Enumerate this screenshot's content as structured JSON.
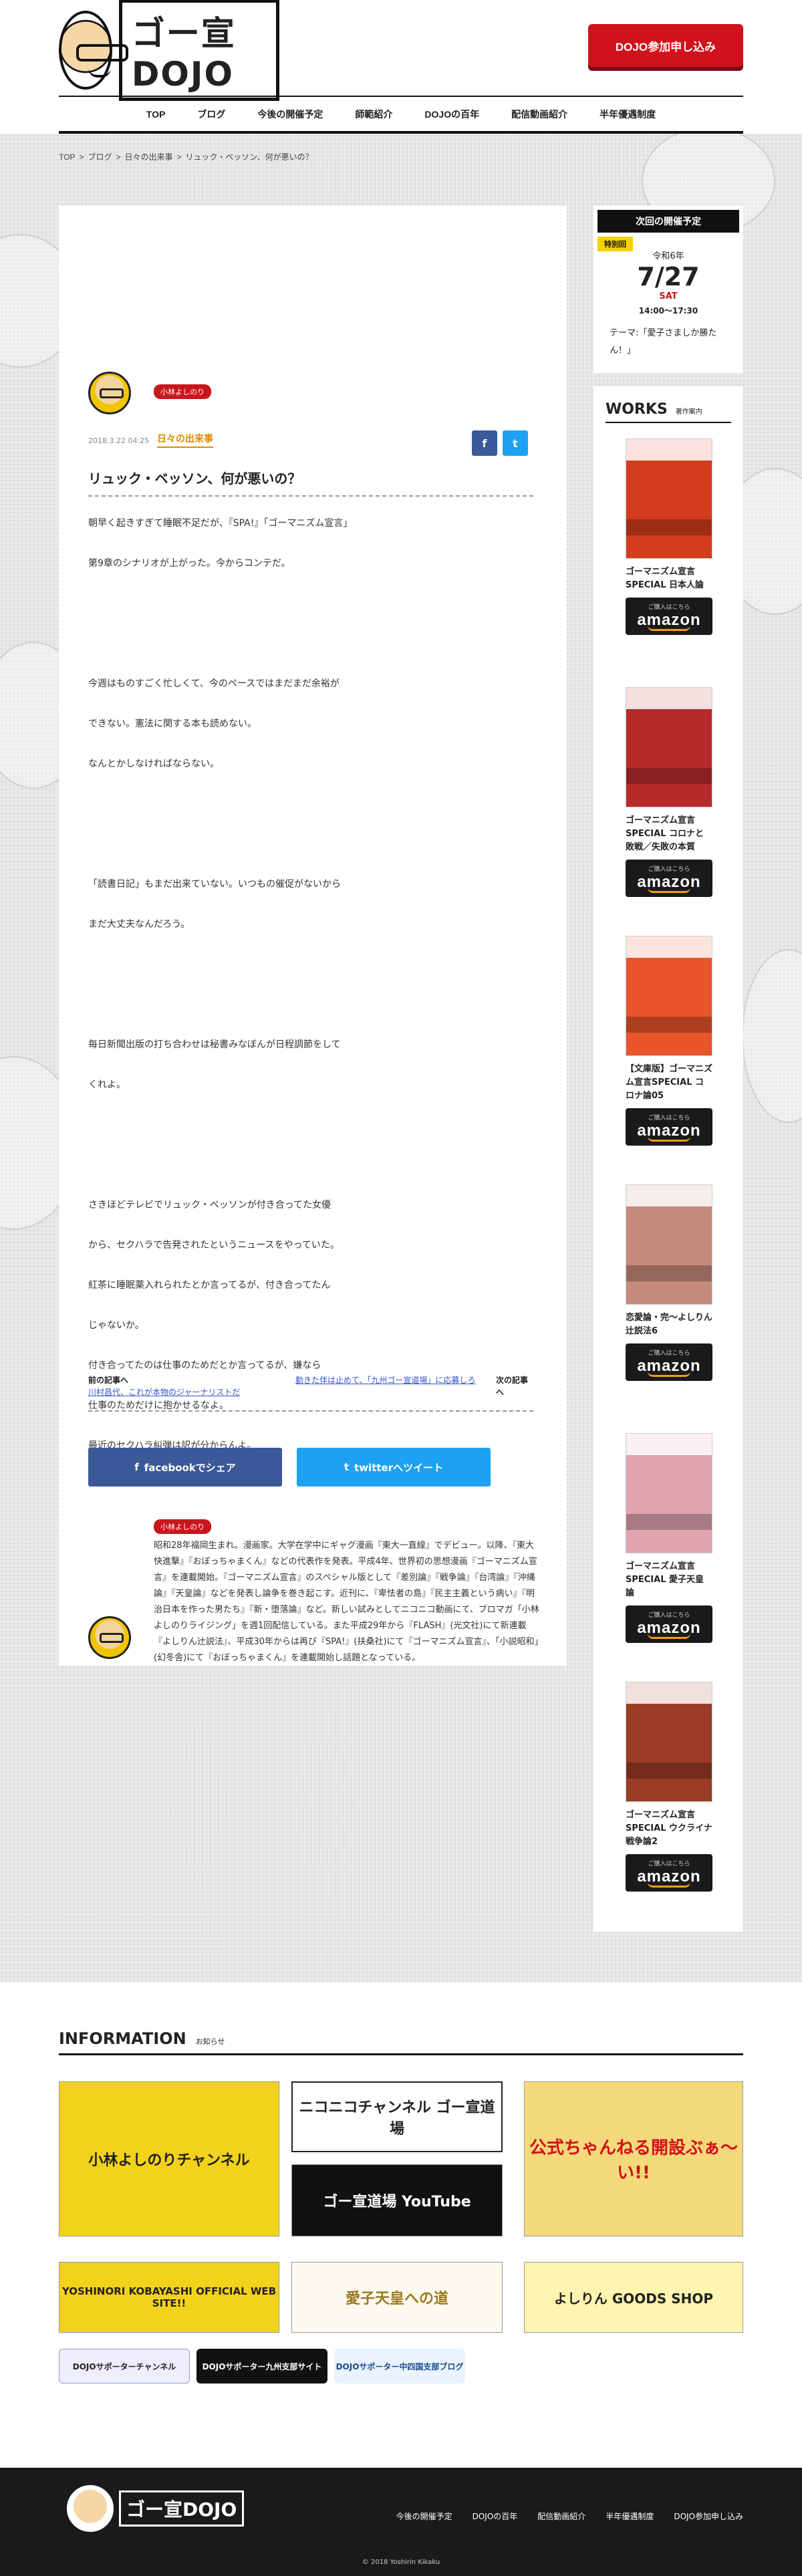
{
  "header": {
    "logo_text": "ゴー宣DOJO",
    "join_label": "DOJO参加申し込み",
    "nav": [
      "TOP",
      "ブログ",
      "今後の開催予定",
      "師範紹介",
      "DOJOの百年",
      "配信動画紹介",
      "半年優遇制度"
    ]
  },
  "breadcrumb": {
    "top": "TOP",
    "blog": "ブログ",
    "category": "日々の出来事",
    "current": "リュック・ベッソン、何が悪いの？",
    "sep": ">"
  },
  "article": {
    "author_tag": "小林よしのり",
    "date": "2018.3.22 04:25",
    "category": "日々の出来事",
    "title": "リュック・ベッソン、何が悪いの？",
    "paragraphs": [
      "朝早く起きすぎて睡眠不足だが、『SPA!』「ゴーマニズム宣言」",
      "第9章のシナリオが上がった。今からコンテだ。",
      "",
      "",
      "今週はものすごく忙しくて、今のペースではまだまだ余裕が",
      "できない。憲法に関する本も読めない。",
      "なんとかしなければならない。",
      "",
      "",
      "「読書日記」もまだ出来ていない。いつもの催促がないから",
      "まだ大丈夫なんだろう。",
      "",
      "",
      "毎日新聞出版の打ち合わせは秘書みなぼんが日程調節をして",
      "くれよ。",
      "",
      "",
      "さきほどテレビでリュック・ベッソンが付き合ってた女優",
      "から、セクハラで告発されたというニュースをやっていた。",
      "紅茶に睡眠薬入れられたとか言ってるが、付き合ってたん",
      "じゃないか。",
      "付き合ってたのは仕事のためだとか言ってるが、嫌なら",
      "仕事のためだけに抱かせるなよ。",
      "最近のセクハラ糾弾は訳が分からんよ。"
    ],
    "prev_label": "前の記事へ",
    "prev_link": "川村昌代、これが本物のジャーナリストだ",
    "next_link": "勤きた伴は止めて、「九州ゴー宣道場」に応募しろ",
    "next_label": "次の記事へ",
    "share_fb_icon": "f",
    "share_tw_icon": "t",
    "share_fb": "facebookでシェア",
    "share_tw": "twitterへツイート",
    "profile_tag": "小林よしのり",
    "profile": "昭和28年福岡生まれ。漫画家。大学在学中にギャグ漫画『東大一直線』でデビュー。以降、『東大快進撃』『おぼっちゃまくん』などの代表作を発表。平成4年、世界初の思想漫画『ゴーマニズム宣言』を連載開始。『ゴーマニズム宣言』のスペシャル版として『差別論』『戦争論』『台湾論』『沖縄論』『天皇論』などを発表し論争を巻き起こす。近刊に、『卑怯者の島』『民主主義という病い』『明治日本を作った男たち』『新・堕落論』など。新しい試みとしてニコニコ動画にて、ブロマガ「小林よしのりライジング」を週1回配信している。また平成29年から『FLASH』(光文社)にて新連載『よしりん辻説法』、平成30年からは再び『SPA!』(扶桑社)にて『ゴーマニズム宣言』、「小説昭和」(幻冬舎)にて『おぼっちゃまくん』を連載開始し話題となっている。"
  },
  "schedule": {
    "heading": "次回の開催予定",
    "badge": "特別回",
    "era": "令和6年",
    "date": "7/27",
    "day": "SAT",
    "time": "14:00〜17:30",
    "theme": "テーマ:「愛子さましか勝たん！」"
  },
  "works": {
    "heading_en": "WORKS",
    "heading_jp": "著作案内",
    "amazon_small": "ご購入はこちら",
    "amazon_brand": "amazon",
    "items": [
      {
        "title": "ゴーマニズム宣言SPECIAL 日本人論",
        "color": "#d43c1e"
      },
      {
        "title": "ゴーマニズム宣言SPECIAL コロナと敗戦／失敗の本質",
        "color": "#b82a2a"
      },
      {
        "title": "【文庫版】ゴーマニズム宣言SPECIAL コロナ論05",
        "color": "#e8552b"
      },
      {
        "title": "恋愛論・完〜よしりん辻説法6",
        "color": "#c48a7a"
      },
      {
        "title": "ゴーマニズム宣言SPECIAL 愛子天皇論",
        "color": "#e0a4b0"
      },
      {
        "title": "ゴーマニズム宣言SPECIAL ウクライナ戦争論2",
        "color": "#9a3b26"
      }
    ]
  },
  "information": {
    "heading_en": "INFORMATION",
    "heading_jp": "お知らせ",
    "banners": [
      "小林よしのりチャンネル",
      "ニコニコチャンネル ゴー宣道場",
      "ゴー宣道場 YouTube",
      "公式ちゃんねる開設ぶぁ〜い!!",
      "YOSHINORI KOBAYASHI OFFICIAL WEB SITE!!",
      "愛子天皇への道",
      "よしりん GOODS SHOP"
    ],
    "small_banners": [
      "DOJOサポーターチャンネル",
      "DOJOサポーター九州支部サイト",
      "DOJOサポーター中四国支部ブログ"
    ]
  },
  "footer": {
    "logo_text": "ゴー宣DOJO",
    "nav": [
      "今後の開催予定",
      "DOJOの百年",
      "配信動画紹介",
      "半年優遇制度",
      "DOJO参加申し込み"
    ],
    "copyright": "© 2018 Yoshirin Kikaku"
  },
  "colors": {
    "accent_red": "#d0121b",
    "category_orange": "#e08a00",
    "facebook": "#3b5998",
    "twitter": "#1da1f2",
    "badge_yellow": "#f5d000"
  }
}
